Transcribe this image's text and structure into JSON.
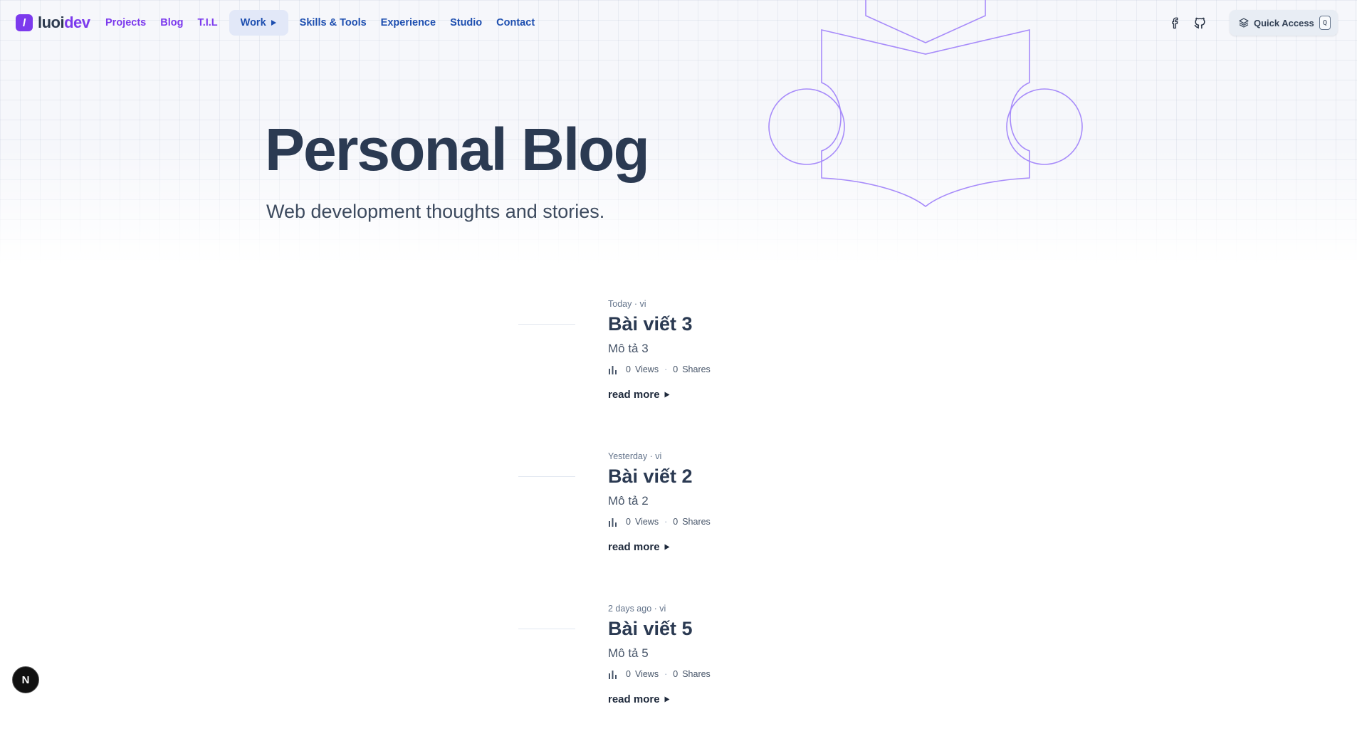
{
  "brand": {
    "mark": "l",
    "name_part1": "luoi",
    "name_part2": "dev"
  },
  "nav": {
    "projects": "Projects",
    "blog": "Blog",
    "til": "T.I.L",
    "work": "Work",
    "skills": "Skills & Tools",
    "experience": "Experience",
    "studio": "Studio",
    "contact": "Contact"
  },
  "header_right": {
    "quick_access_label": "Quick Access",
    "quick_access_key": "Q"
  },
  "hero": {
    "title": "Personal Blog",
    "subtitle": "Web development thoughts and stories."
  },
  "posts": [
    {
      "date": "Today",
      "lang": "vi",
      "title": "Bài viết 3",
      "description": "Mô tả 3",
      "views": "0",
      "views_label": "Views",
      "shares": "0",
      "shares_label": "Shares",
      "read_more": "read more"
    },
    {
      "date": "Yesterday",
      "lang": "vi",
      "title": "Bài viết 2",
      "description": "Mô tả 2",
      "views": "0",
      "views_label": "Views",
      "shares": "0",
      "shares_label": "Shares",
      "read_more": "read more"
    },
    {
      "date": "2 days ago",
      "lang": "vi",
      "title": "Bài viết 5",
      "description": "Mô tả 5",
      "views": "0",
      "views_label": "Views",
      "shares": "0",
      "shares_label": "Shares",
      "read_more": "read more"
    }
  ],
  "next_badge": {
    "letter": "N"
  },
  "icons": {
    "facebook": "facebook-icon",
    "github": "github-icon",
    "quick_access": "layers-icon",
    "work_arrow": "play-arrow-icon",
    "stats": "bar-chart-icon",
    "read_more_arrow": "play-arrow-icon"
  },
  "colors": {
    "accent_purple": "#7c3aed",
    "nav_blue": "#1e4fb0",
    "heading": "#2b3a52",
    "hero_art_stroke": "#a78bfa"
  }
}
